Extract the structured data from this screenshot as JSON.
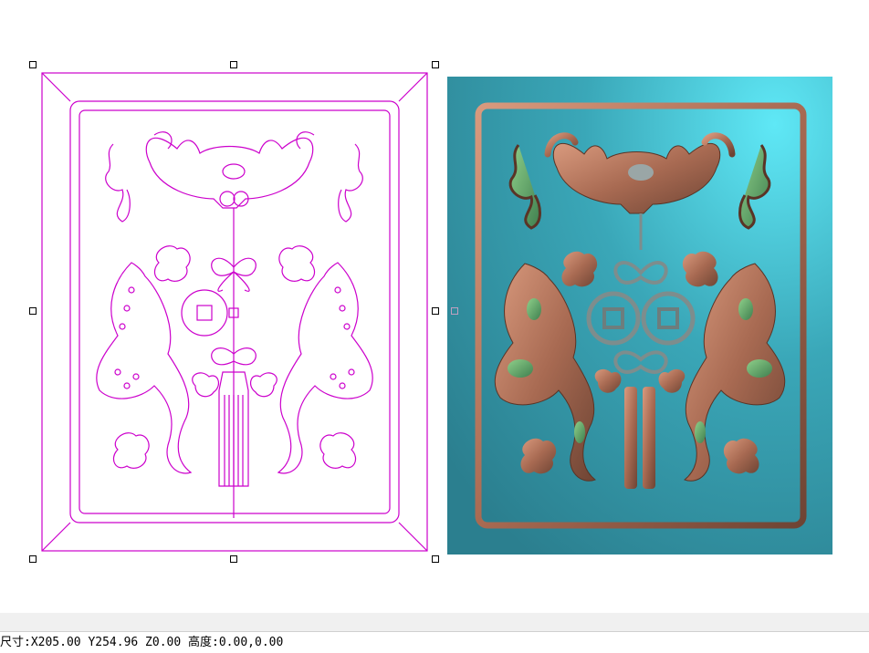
{
  "status": {
    "size_label": "尺寸:",
    "coords": "X205.00 Y254.96 Z0.00",
    "height_label": "高度:",
    "height_value": "0.00,0.00"
  },
  "colors": {
    "wireframe": "#cc00cc",
    "relief_bg": "#3aa7b8",
    "relief_frame": "#b07a60",
    "relief_accent": "#5ea86a",
    "selection_handle": "#000000"
  },
  "icons": {
    "selection": "square-handle"
  }
}
